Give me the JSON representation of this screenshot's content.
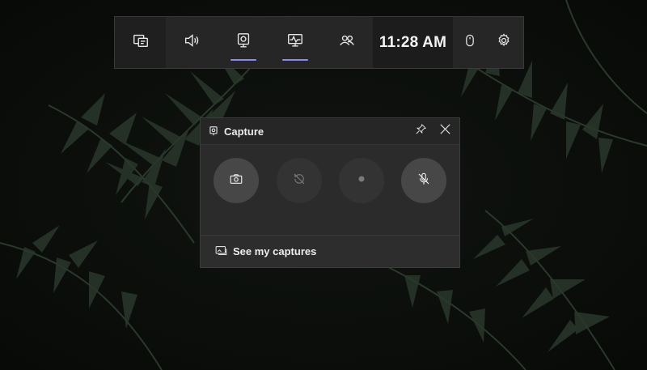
{
  "colors": {
    "bar_background": "#262626",
    "widget_background": "#2b2b2b",
    "accent_underline": "#8a8ee8",
    "text": "#ececec"
  },
  "topbar": {
    "widget_menu_icon": "widget-menu-icon",
    "audio_icon": "speaker-icon",
    "capture_icon": "capture-webcam-icon",
    "performance_icon": "monitor-performance-icon",
    "xbox_social_icon": "people-icon",
    "clock": "11:28 AM",
    "mouse_icon": "mouse-icon",
    "settings_icon": "gear-icon"
  },
  "capture": {
    "title": "Capture",
    "pin_icon": "pin-icon",
    "close_icon": "close-icon",
    "buttons": [
      {
        "name": "screenshot",
        "icon": "camera-icon",
        "state": "enabled"
      },
      {
        "name": "record-last",
        "icon": "rewind-record-icon",
        "state": "disabled"
      },
      {
        "name": "start-recording",
        "icon": "record-dot-icon",
        "state": "disabled"
      },
      {
        "name": "mic-toggle",
        "icon": "mic-off-icon",
        "state": "enabled"
      }
    ],
    "footer_label": "See my captures"
  }
}
